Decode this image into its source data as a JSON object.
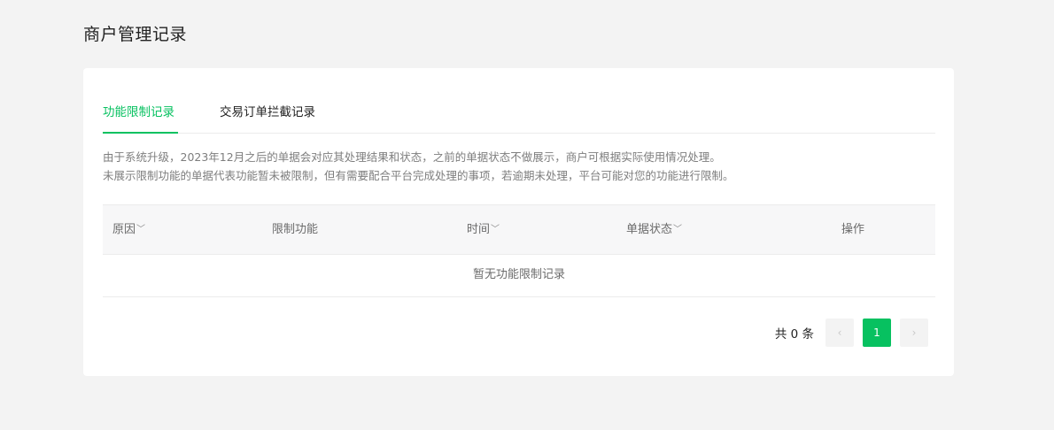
{
  "page": {
    "title": "商户管理记录"
  },
  "tabs": [
    {
      "label": "功能限制记录",
      "active": true
    },
    {
      "label": "交易订单拦截记录",
      "active": false
    }
  ],
  "notice": {
    "line1": "由于系统升级，2023年12月之后的单据会对应其处理结果和状态，之前的单据状态不做展示，商户可根据实际使用情况处理。",
    "line2": "未展示限制功能的单据代表功能暂未被限制，但有需要配合平台完成处理的事项，若逾期未处理，平台可能对您的功能进行限制。"
  },
  "table": {
    "columns": [
      {
        "label": "原因",
        "sortable": true
      },
      {
        "label": "限制功能",
        "sortable": false
      },
      {
        "label": "时间",
        "sortable": true
      },
      {
        "label": "单据状态",
        "sortable": true
      },
      {
        "label": "操作",
        "sortable": false
      }
    ],
    "empty_text": "暂无功能限制记录"
  },
  "pagination": {
    "total_text": "共 0 条",
    "current_page": "1",
    "prev_icon": "‹",
    "next_icon": "›"
  },
  "colors": {
    "accent": "#07c160",
    "background": "#f3f3f3"
  }
}
